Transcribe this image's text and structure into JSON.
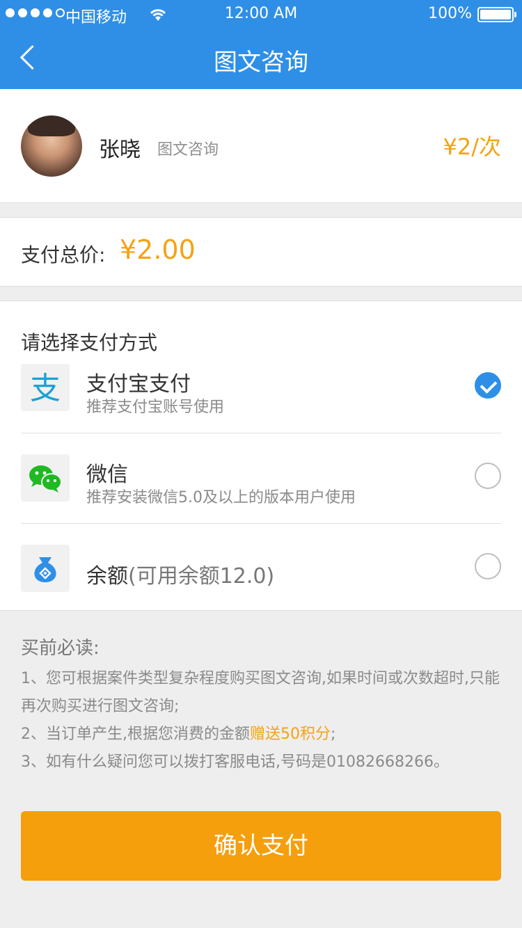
{
  "status_bar": {
    "carrier": "中国移动",
    "time": "12:00 AM",
    "battery": "100%"
  },
  "nav": {
    "title": "图文咨询"
  },
  "consultant": {
    "name": "张晓",
    "service": "图文咨询",
    "price": "¥2/次"
  },
  "total": {
    "label": "支付总价:",
    "amount": "¥2.00"
  },
  "payment": {
    "section_title": "请选择支付方式",
    "methods": [
      {
        "title": "支付宝支付",
        "subtitle": "推荐支付宝账号使用",
        "icon": "alipay-icon",
        "selected": true
      },
      {
        "title": "微信",
        "subtitle": "推荐安装微信5.0及以上的版本用户使用",
        "icon": "wechat-icon",
        "selected": false
      },
      {
        "title": "余额",
        "balance_note": "(可用余额12.0)",
        "icon": "money-bag-icon",
        "selected": false
      }
    ]
  },
  "notice": {
    "title": "买前必读:",
    "item1": "1、您可根据案件类型复杂程度购买图文咨询,如果时间或次数超时,只能再次购买进行图文咨询;",
    "item2_prefix": "2、当订单产生,根据您消费的金额",
    "item2_highlight": "赠送50积分",
    "item2_suffix": ";",
    "item3": "3、如有什么疑问您可以拨打客服电话,号码是01082668266。"
  },
  "confirm_label": "确认支付",
  "colors": {
    "primary": "#2f8fe6",
    "accent": "#f5a213",
    "button": "#f59f0c",
    "wechat_green": "#1fb922",
    "alipay_blue": "#1aa2d5"
  }
}
